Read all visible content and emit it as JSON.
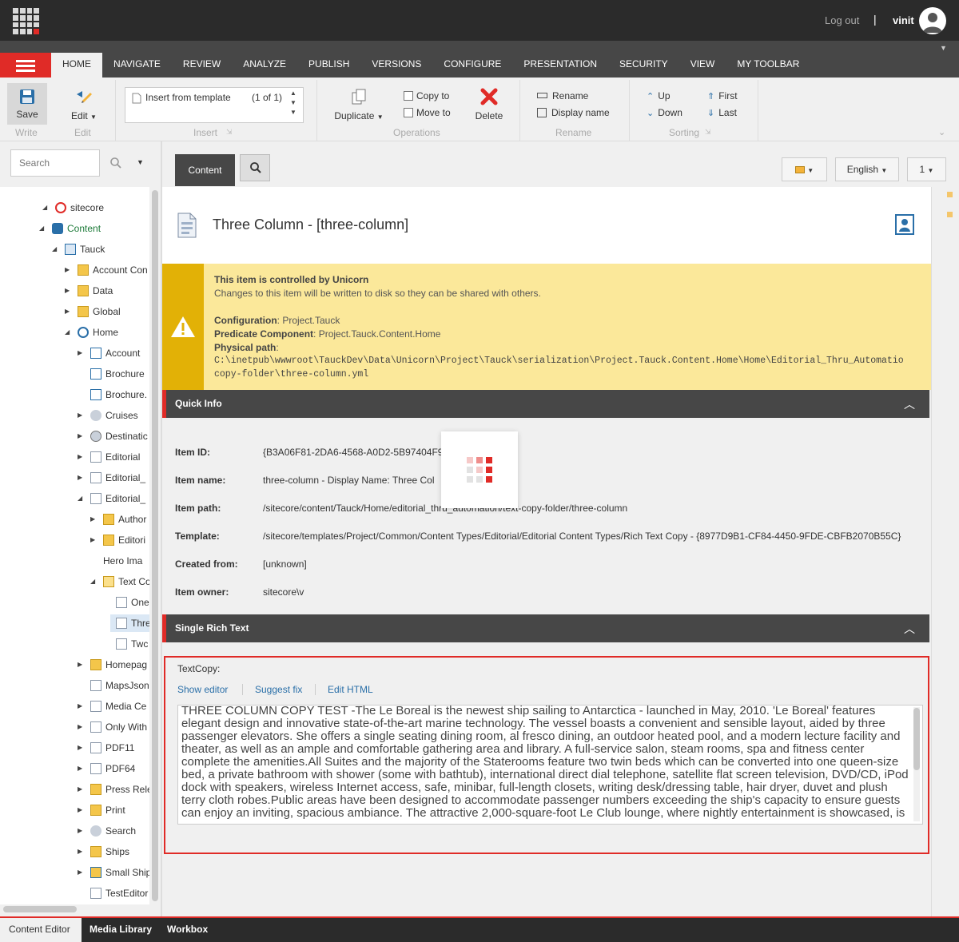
{
  "topbar": {
    "logout": "Log out",
    "separator": "|",
    "username": "vinit"
  },
  "ribbon_tabs": [
    "HOME",
    "NAVIGATE",
    "REVIEW",
    "ANALYZE",
    "PUBLISH",
    "VERSIONS",
    "CONFIGURE",
    "PRESENTATION",
    "SECURITY",
    "VIEW",
    "MY TOOLBAR"
  ],
  "ribbon": {
    "save": "Save",
    "edit": "Edit",
    "write": "Write",
    "edit_group": "Edit",
    "insert_template": "Insert from template",
    "insert_count": "(1 of 1)",
    "insert_group": "Insert",
    "duplicate": "Duplicate",
    "copy_to": "Copy to",
    "move_to": "Move to",
    "delete": "Delete",
    "operations_group": "Operations",
    "rename": "Rename",
    "display_name": "Display name",
    "rename_group": "Rename",
    "up": "Up",
    "down": "Down",
    "first": "First",
    "last": "Last",
    "sorting_group": "Sorting"
  },
  "search": {
    "placeholder": "Search"
  },
  "tree": [
    {
      "label": "sitecore",
      "level": 0,
      "arrow": "open",
      "icon": "sitecore-icon"
    },
    {
      "label": "Content",
      "level": 1,
      "arrow": "open",
      "icon": "content-icon",
      "green": true
    },
    {
      "label": "Tauck",
      "level": 2,
      "arrow": "open",
      "icon": "site-icon"
    },
    {
      "label": "Account Con",
      "level": 3,
      "arrow": "closed",
      "icon": "folder-icon"
    },
    {
      "label": "Data",
      "level": 3,
      "arrow": "closed",
      "icon": "folder-icon"
    },
    {
      "label": "Global",
      "level": 3,
      "arrow": "closed",
      "icon": "folder-icon"
    },
    {
      "label": "Home",
      "level": 3,
      "arrow": "open",
      "icon": "home-icon"
    },
    {
      "label": "Account",
      "level": 4,
      "arrow": "closed",
      "icon": "grid-icon"
    },
    {
      "label": "Brochure",
      "level": 4,
      "arrow": "none",
      "icon": "grid-icon"
    },
    {
      "label": "Brochure.",
      "level": 4,
      "arrow": "none",
      "icon": "grid-icon"
    },
    {
      "label": "Cruises",
      "level": 4,
      "arrow": "closed",
      "icon": "ship-icon"
    },
    {
      "label": "Destinatic",
      "level": 4,
      "arrow": "closed",
      "icon": "globe-icon"
    },
    {
      "label": "Editorial",
      "level": 4,
      "arrow": "closed",
      "icon": "document-icon"
    },
    {
      "label": "Editorial_",
      "level": 4,
      "arrow": "closed",
      "icon": "document-icon"
    },
    {
      "label": "Editorial_",
      "level": 4,
      "arrow": "open",
      "icon": "document-icon"
    },
    {
      "label": "Author",
      "level": 5,
      "arrow": "closed",
      "icon": "folder-icon"
    },
    {
      "label": "Editori",
      "level": 5,
      "arrow": "closed",
      "icon": "folder-icon"
    },
    {
      "label": "Hero Ima",
      "level": 5,
      "arrow": "none",
      "icon": ""
    },
    {
      "label": "Text Co",
      "level": 5,
      "arrow": "open",
      "icon": "folder-open-icon"
    },
    {
      "label": "One",
      "level": 6,
      "arrow": "none",
      "icon": "document-icon"
    },
    {
      "label": "Thre",
      "level": 6,
      "arrow": "none",
      "icon": "document-icon",
      "selected": true
    },
    {
      "label": "Twc",
      "level": 6,
      "arrow": "none",
      "icon": "document-icon"
    },
    {
      "label": "Homepag",
      "level": 4,
      "arrow": "closed",
      "icon": "folder-icon"
    },
    {
      "label": "MapsJson",
      "level": 4,
      "arrow": "none",
      "icon": "document-icon"
    },
    {
      "label": "Media Ce",
      "level": 4,
      "arrow": "closed",
      "icon": "document-icon"
    },
    {
      "label": "Only With",
      "level": 4,
      "arrow": "closed",
      "icon": "document-icon"
    },
    {
      "label": "PDF11",
      "level": 4,
      "arrow": "closed",
      "icon": "document-icon"
    },
    {
      "label": "PDF64",
      "level": 4,
      "arrow": "closed",
      "icon": "document-icon"
    },
    {
      "label": "Press Rele",
      "level": 4,
      "arrow": "closed",
      "icon": "folder-icon"
    },
    {
      "label": "Print",
      "level": 4,
      "arrow": "closed",
      "icon": "folder-icon"
    },
    {
      "label": "Search",
      "level": 4,
      "arrow": "closed",
      "icon": "ship-icon"
    },
    {
      "label": "Ships",
      "level": 4,
      "arrow": "closed",
      "icon": "folder-icon"
    },
    {
      "label": "Small Ship",
      "level": 4,
      "arrow": "closed",
      "icon": "folder-lock-icon"
    },
    {
      "label": "TestEditor",
      "level": 4,
      "arrow": "none",
      "icon": "document-icon"
    }
  ],
  "editor": {
    "content_tab": "Content",
    "language": "English",
    "version": "1",
    "item_title": "Three Column - [three-column]"
  },
  "unicorn": {
    "title": "This item is controlled by Unicorn",
    "subtitle": "Changes to this item will be written to disk so they can be shared with others.",
    "config_label": "Configuration",
    "config_value": "Project.Tauck",
    "predicate_label": "Predicate Component",
    "predicate_value": "Project.Tauck.Content.Home",
    "path_label": "Physical path",
    "path_line1": "C:\\inetpub\\wwwroot\\TauckDev\\Data\\Unicorn\\Project\\Tauck\\serialization\\Project.Tauck.Content.Home\\Home\\Editorial_Thru_Automatio",
    "path_line2": "copy-folder\\three-column.yml"
  },
  "quick_info": {
    "title": "Quick Info",
    "rows": [
      {
        "label": "Item ID:",
        "value": "{B3A06F81-2DA6-4568-A0D2-5B97404F9"
      },
      {
        "label": "Item name:",
        "value": "three-column - Display Name: Three Col"
      },
      {
        "label": "Item path:",
        "value": "/sitecore/content/Tauck/Home/editorial_thru_automation/text-copy-folder/three-column"
      },
      {
        "label": "Template:",
        "value": "/sitecore/templates/Project/Common/Content Types/Editorial/Editorial Content Types/Rich Text Copy - {8977D9B1-CF84-4450-9FDE-CBFB2070B55C}"
      },
      {
        "label": "Created from:",
        "value": "[unknown]"
      },
      {
        "label": "Item owner:",
        "value": "sitecore\\v"
      }
    ]
  },
  "rich_text": {
    "section_title": "Single Rich Text",
    "field_label": "TextCopy:",
    "show_editor": "Show editor",
    "suggest_fix": "Suggest fix",
    "edit_html": "Edit HTML",
    "text": "THREE COLUMN COPY TEST -The Le Boreal is the newest ship sailing to Antarctica - launched in May, 2010. 'Le Boreal' features elegant design and innovative state-of-the-art marine technology. The vessel boasts a convenient and sensible layout, aided by three passenger elevators. She offers a single seating dining room, al fresco dining, an outdoor heated pool, and a modern lecture facility and theater, as well as an ample and comfortable gathering area and library. A full-service salon, steam rooms, spa and fitness center complete the amenities.All Suites and the majority of the Staterooms feature two twin beds which can be converted into one queen-size bed, a private bathroom with shower (some with bathtub), international direct dial telephone, satellite flat screen television, DVD/CD, iPod dock with speakers, wireless Internet access, safe, minibar, full-length closets, writing desk/dressing table, hair dryer, duvet and plush terry cloth robes.Public areas have been designed to accommodate passenger numbers exceeding the ship's capacity to ensure guests can enjoy an inviting, spacious ambiance. The attractive 2,000-square-foot Le Club lounge, where nightly entertainment is showcased, is"
  },
  "bottom_tabs": [
    "Content Editor",
    "Media Library",
    "Workbox"
  ],
  "colors": {
    "accent": "#e02b27",
    "dark": "#2b2b2b",
    "ribbon": "#474747",
    "warning": "#fbe89a",
    "warning_side": "#e2b106"
  }
}
